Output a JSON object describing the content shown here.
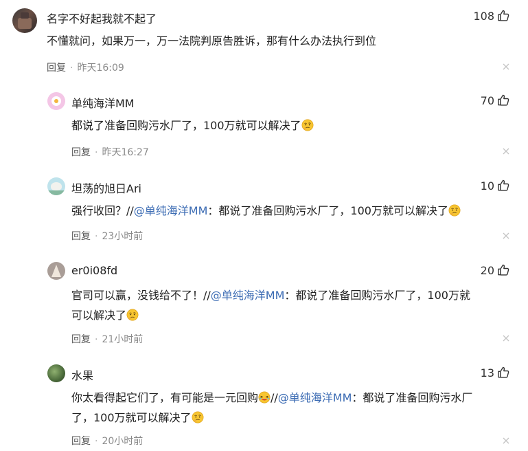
{
  "comments": [
    {
      "user": "名字不好起我就不起了",
      "likes": "108",
      "text": "不懂就问，如果万一，万一法院判原告胜诉，那有什么办法执行到位",
      "reply_label": "回复",
      "time": "昨天16:09"
    },
    {
      "user": "单纯海洋MM",
      "likes": "70",
      "text": "都说了准备回购污水厂了，100万就可以解决了",
      "reply_label": "回复",
      "time": "昨天16:27"
    },
    {
      "user": "坦荡的旭日Ari",
      "likes": "10",
      "prefix": "强行收回？//",
      "mention": "@单纯海洋MM",
      "suffix": "：都说了准备回购污水厂了，100万就可以解决了",
      "reply_label": "回复",
      "time": "23小时前"
    },
    {
      "user": "er0i08fd",
      "likes": "20",
      "prefix": "官司可以赢，没钱给不了！//",
      "mention": "@单纯海洋MM",
      "suffix_line1": "：都说了准备回购污水厂了，100万就",
      "line2": "可以解决了",
      "reply_label": "回复",
      "time": "21小时前"
    },
    {
      "user": "水果",
      "likes": "13",
      "prefix": "你太看得起它们了，有可能是一元回购",
      "mid": "//",
      "mention": "@单纯海洋MM",
      "suffix_line1": "：都说了准备回购污水厂",
      "line2": "了，100万就可以解决了",
      "reply_label": "回复",
      "time": "20小时前"
    }
  ],
  "icons": {
    "like": "thumbs-up-icon",
    "close": "close-icon",
    "emoji_think": "thinking-face-emoji",
    "emoji_laugh": "laughing-face-emoji"
  },
  "colors": {
    "mention": "#3b6bb3",
    "meta": "#8a8a8a"
  }
}
